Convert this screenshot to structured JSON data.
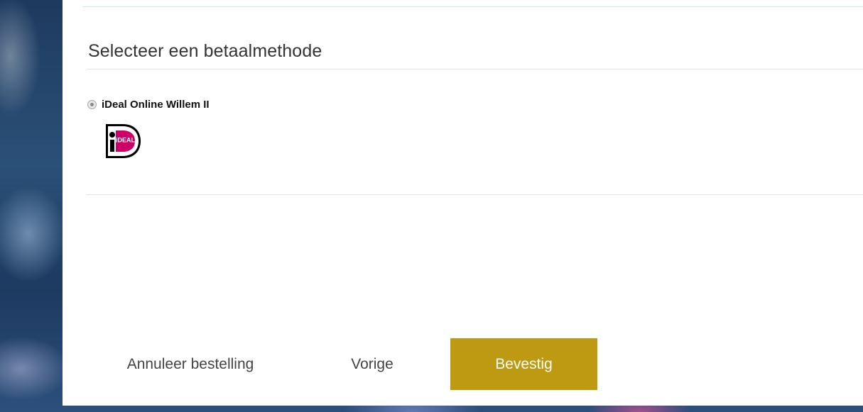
{
  "payment": {
    "title": "Selecteer een betaalmethode",
    "methods": [
      {
        "label": "iDeal Online Willem II",
        "selected": true,
        "logo_icon": "ideal-logo-icon",
        "logo_text": "iDEAL"
      }
    ]
  },
  "actions": {
    "cancel_label": "Annuleer bestelling",
    "previous_label": "Vorige",
    "confirm_label": "Bevestig"
  },
  "colors": {
    "confirm_button": "#bd9a12",
    "ideal_pink": "#cc0066",
    "divider": "#e3e3e3"
  }
}
